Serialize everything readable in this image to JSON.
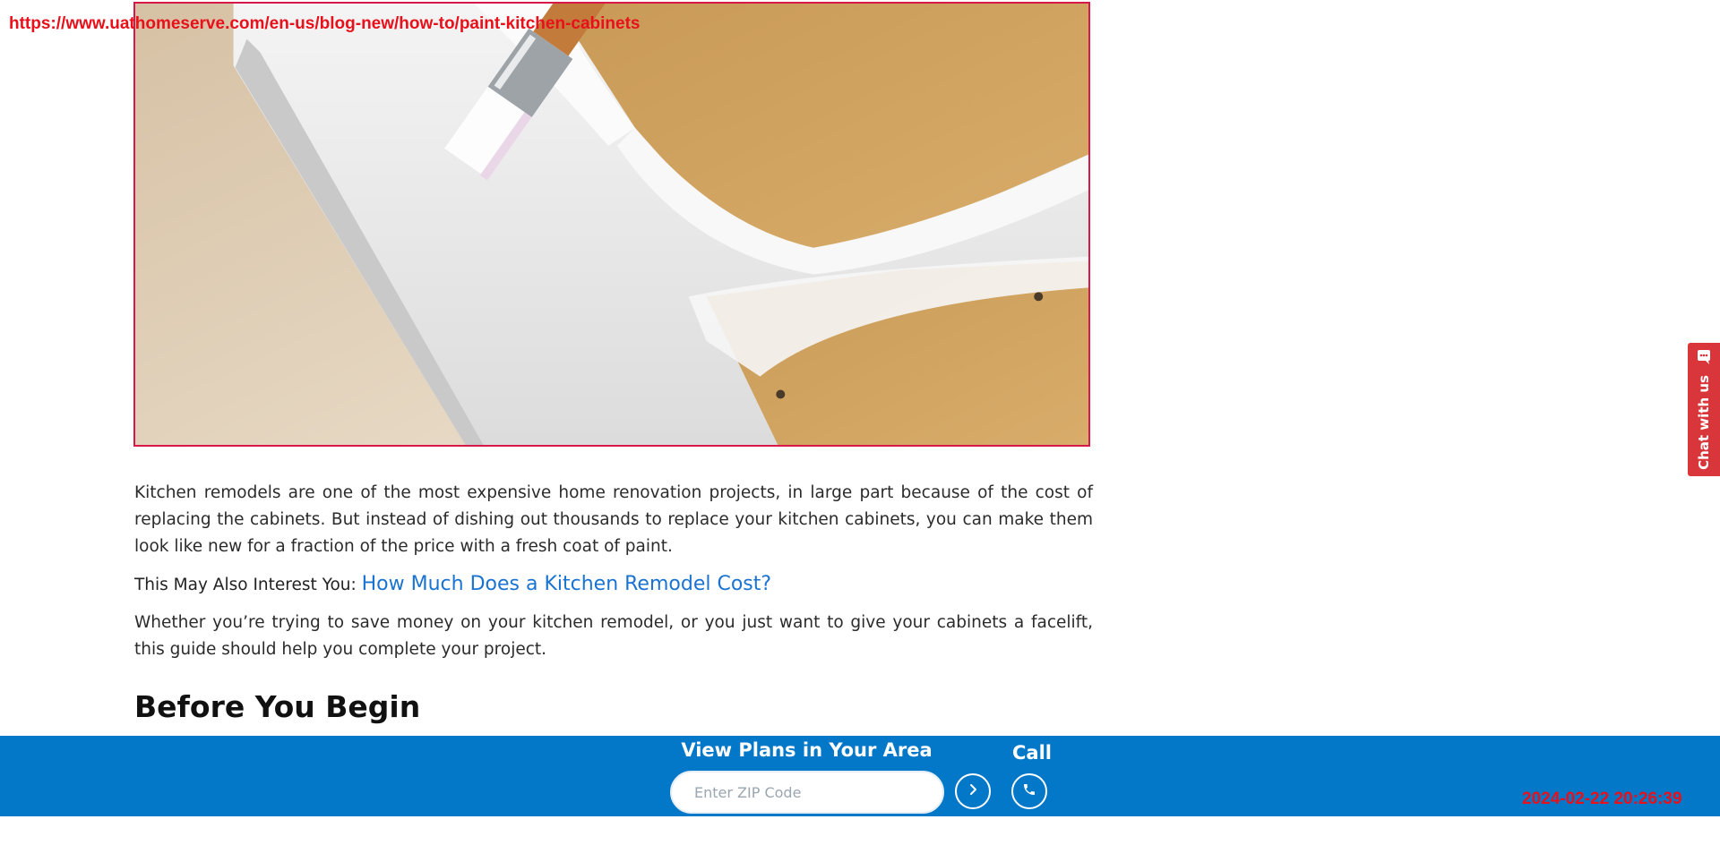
{
  "browser": {
    "url": "https://www.uathomeserve.com/en-us/blog-new/how-to/paint-kitchen-cabinets",
    "timestamp": "2024-02-22 20:26:39"
  },
  "article": {
    "hero_image": "painting-kitchen-cabinet-door-white",
    "paragraph1": "Kitchen remodels are one of the most expensive home renovation projects, in large part because of the cost of replacing the cabinets. But instead of dishing out thousands to replace your kitchen cabinets, you can make them look like new for a fraction of the price with a fresh coat of paint.",
    "interest_prefix": "This May Also Interest You:",
    "interest_link": "How Much Does a Kitchen Remodel Cost?",
    "paragraph2": "Whether you’re trying to save money on your kitchen remodel, or you just want to give your cabinets a facelift, this guide should help you complete your project.",
    "section_heading": "Before You Begin"
  },
  "bottom_bar": {
    "plans_title": "View Plans in Your Area",
    "zip_placeholder": "Enter ZIP Code",
    "zip_value": "",
    "call_label": "Call",
    "go_icon": "chevron-right-icon",
    "call_icon": "phone-icon",
    "background": "#0478c8"
  },
  "chat": {
    "label": "Chat with us",
    "icon": "chat-bubble-icon",
    "background": "#d8363a"
  }
}
